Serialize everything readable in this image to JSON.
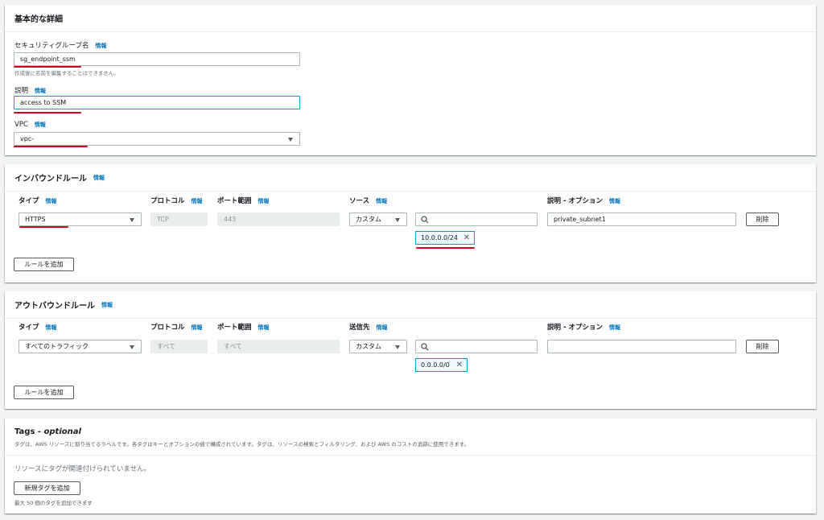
{
  "info_label": "情報",
  "basic": {
    "title": "基本的な詳細",
    "sg_name_label": "セキュリティグループ名",
    "sg_name_value": "sg_endpoint_ssm",
    "sg_name_hint": "作成後に名前を編集することはできません。",
    "desc_label": "説明",
    "desc_value": "access to SSM",
    "vpc_label": "VPC",
    "vpc_value": "vpc-"
  },
  "inbound": {
    "title": "インバウンドルール",
    "col_type": "タイプ",
    "col_protocol": "プロトコル",
    "col_port": "ポート範囲",
    "col_source": "ソース",
    "col_desc": "説明 - オプション",
    "row": {
      "type": "HTTPS",
      "protocol": "TCP",
      "port": "443",
      "source": "カスタム",
      "token": "10.0.0.0/24",
      "description": "private_subnet1",
      "delete": "削除"
    },
    "add_rule": "ルールを追加"
  },
  "outbound": {
    "title": "アウトバウンドルール",
    "col_type": "タイプ",
    "col_protocol": "プロトコル",
    "col_port": "ポート範囲",
    "col_dest": "送信先",
    "col_desc": "説明 - オプション",
    "row": {
      "type": "すべてのトラフィック",
      "protocol": "すべて",
      "port": "すべて",
      "dest": "カスタム",
      "token": "0.0.0.0/0",
      "description": "",
      "delete": "削除"
    },
    "add_rule": "ルールを追加"
  },
  "tags": {
    "title": "Tags - ",
    "title_optional": "optional",
    "subtitle": "タグは、AWS リソースに割り当てるラベルです。各タグはキーとオプションの値で構成されています。タグは、リソースの検索とフィルタリング、および AWS のコストの追跡に使用できます。",
    "empty": "リソースにタグが関連付けられていません。",
    "add_tag": "新規タグを追加",
    "limit_hint": "最大 50 個のタグを追加できます"
  },
  "colors": {
    "accent": "#0073bb",
    "focus": "#00a1c9",
    "annotation": "#d0021b"
  }
}
